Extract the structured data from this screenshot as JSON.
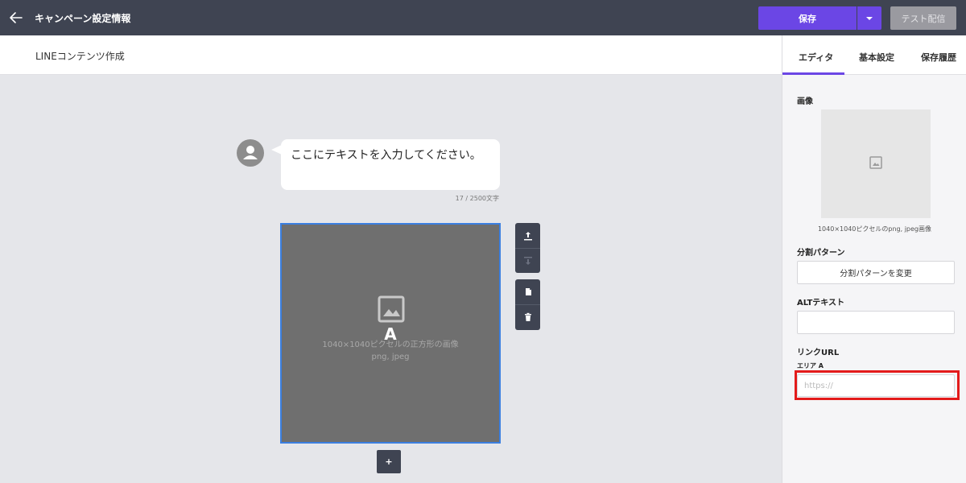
{
  "header": {
    "title": "キャンペーン設定情報",
    "save_label": "保存",
    "test_label": "テスト配信"
  },
  "subheader": {
    "title": "LINEコンテンツ作成"
  },
  "message": {
    "text": "ここにテキストを入力してください。",
    "char_count": "17 / 2500文字"
  },
  "imagemap": {
    "area_letter": "A",
    "hint_line1": "1040×1040ピクセルの正方形の画像",
    "hint_line2": "png, jpeg",
    "add_label": "+"
  },
  "panel": {
    "tabs": [
      {
        "label": "エディタ",
        "active": true
      },
      {
        "label": "基本設定",
        "active": false
      },
      {
        "label": "保存履歴",
        "active": false
      }
    ],
    "image_label": "画像",
    "image_caption": "1040×1040ピクセルのpng, jpeg画像",
    "split_label": "分割パターン",
    "split_button": "分割パターンを変更",
    "alt_label": "ALTテキスト",
    "alt_value": "",
    "link_label": "リンクURL",
    "area_label": "エリア A",
    "url_placeholder": "https://",
    "url_value": ""
  },
  "colors": {
    "topbar": "#3f4452",
    "accent": "#6b46e5",
    "highlight": "#e31b1b",
    "selection": "#3b7fe0"
  },
  "icons": {
    "back": "arrow-left-icon",
    "dropdown": "caret-down-icon",
    "avatar": "user-icon",
    "image": "image-icon",
    "move_up": "upload-icon",
    "move_down": "download-icon",
    "duplicate": "copy-icon",
    "delete": "trash-icon"
  }
}
